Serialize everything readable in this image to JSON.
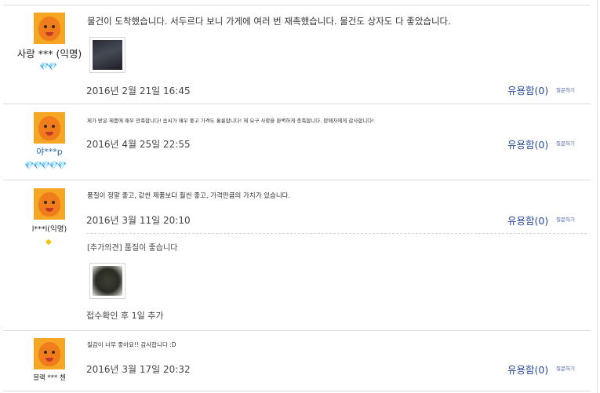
{
  "reviews": [
    {
      "nickname": "사랑 *** (익명)",
      "badge": "💎💎",
      "text": "물건이 도착했습니다. 서두르다 보니 가게에 여러 번 재촉했습니다. 물건도 상자도 다 좋았습니다.",
      "date": "2016년 2월 21일 16:45",
      "helpful": "유용함(0)",
      "ask": "질문하기"
    },
    {
      "nickname": "야***p",
      "badge": "💎💎💎💎💎",
      "text": "제가 받은 제품에 매우 만족합니다! 솜씨가 매우 좋고 가격도 훌륭합니다! 제 요구 사항을 완벽하게 충족합니다. 판매자에게 감사합니다!",
      "date": "2016년 4월 25일 22:55",
      "helpful": "유용함(0)",
      "ask": "질문하기"
    },
    {
      "nickname": "l***l(익명)",
      "badge": "◆",
      "text": "품질이 정말 좋고, 값싼 제품보다 훨씬 좋고, 가격만큼의 가치가 있습니다.",
      "date": "2016년 3월 11일 20:10",
      "helpful": "유용함(0)",
      "ask": "질문하기",
      "followup_text": "[추가의견] 품질이 좋습니다",
      "followup_note": "접수확인 후 1일 추가"
    },
    {
      "nickname": "블랙 *** 첸",
      "text": "질감이 너무 좋아요!! 감사합니다 :D",
      "date": "2016년 3월 17일 20:32",
      "helpful": "유용함(0)",
      "ask": "질문하기"
    }
  ],
  "colors": {
    "link": "#2a4a9a",
    "badge_red": "#e0312b",
    "badge_gold": "#f2c200",
    "avatar": "#f5a623"
  }
}
